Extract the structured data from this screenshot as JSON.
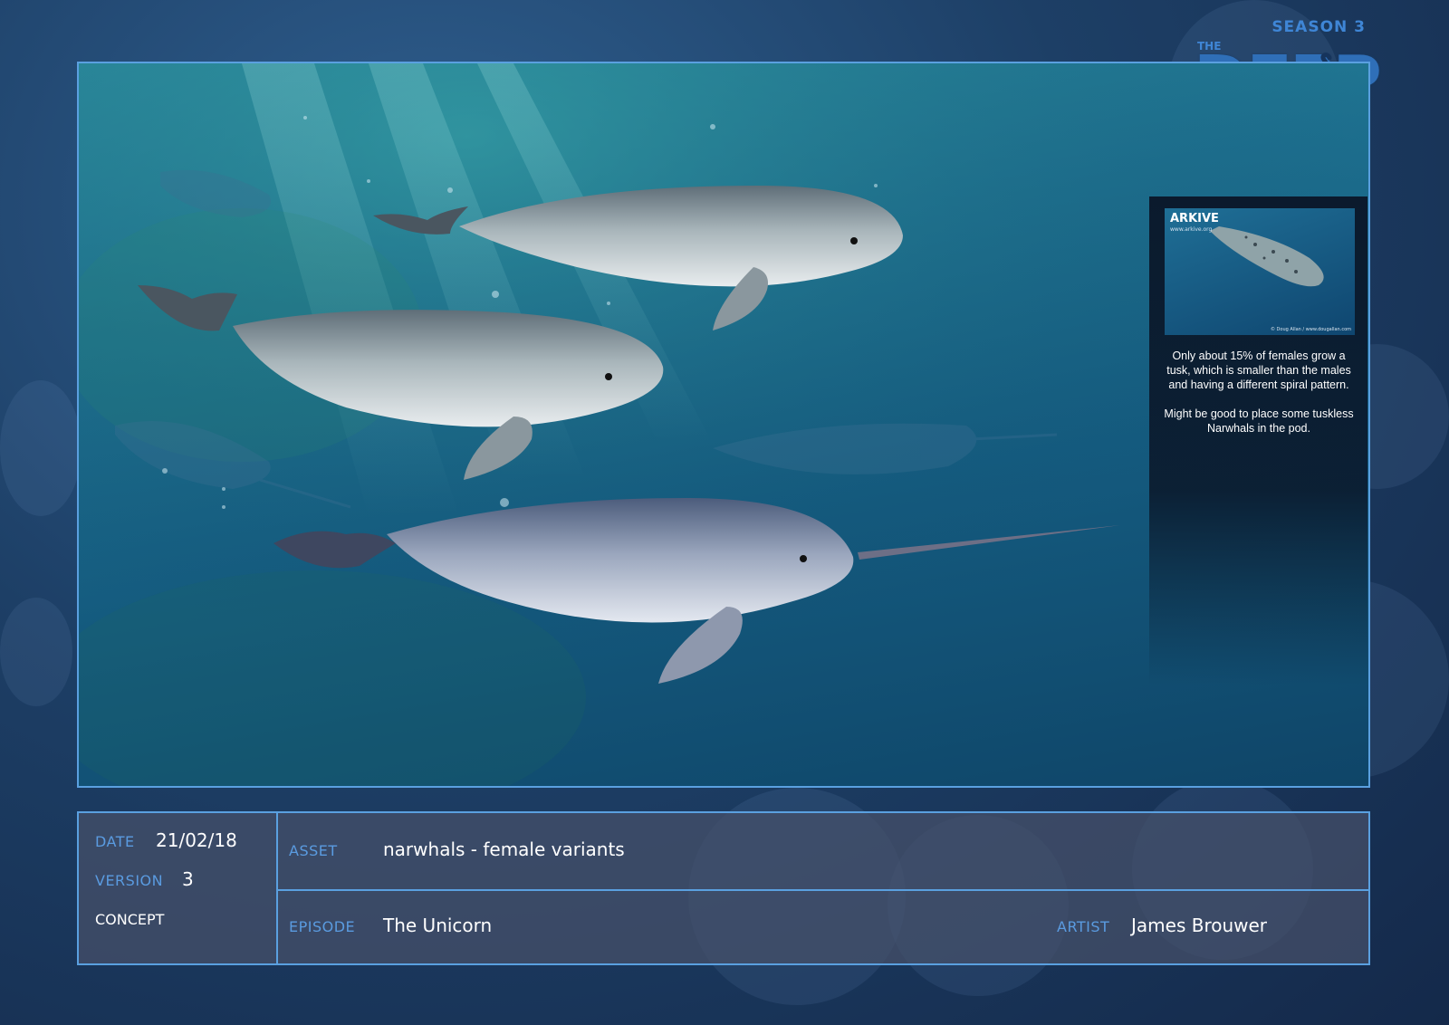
{
  "header": {
    "season": "SEASON 3",
    "logo_the": "THE",
    "logo_deep": "DEEP"
  },
  "artwork": {
    "reference": {
      "photo_logo": "ARKIVE",
      "photo_url": "www.arkive.org",
      "photo_credit": "© Doug Allan / www.dougallan.com",
      "note_1": "Only about 15% of females grow a tusk, which is smaller than the males and having a different spiral pattern.",
      "note_2": "Might be good to place some tuskless Narwhals in the pod."
    }
  },
  "info": {
    "date_label": "DATE",
    "date_value": "21/02/18",
    "version_label": "VERSION",
    "version_value": "3",
    "stage": "CONCEPT",
    "asset_label": "ASSET",
    "asset_value": "narwhals - female variants",
    "episode_label": "EPISODE",
    "episode_value": "The Unicorn",
    "artist_label": "ARTIST",
    "artist_value": "James Brouwer"
  }
}
